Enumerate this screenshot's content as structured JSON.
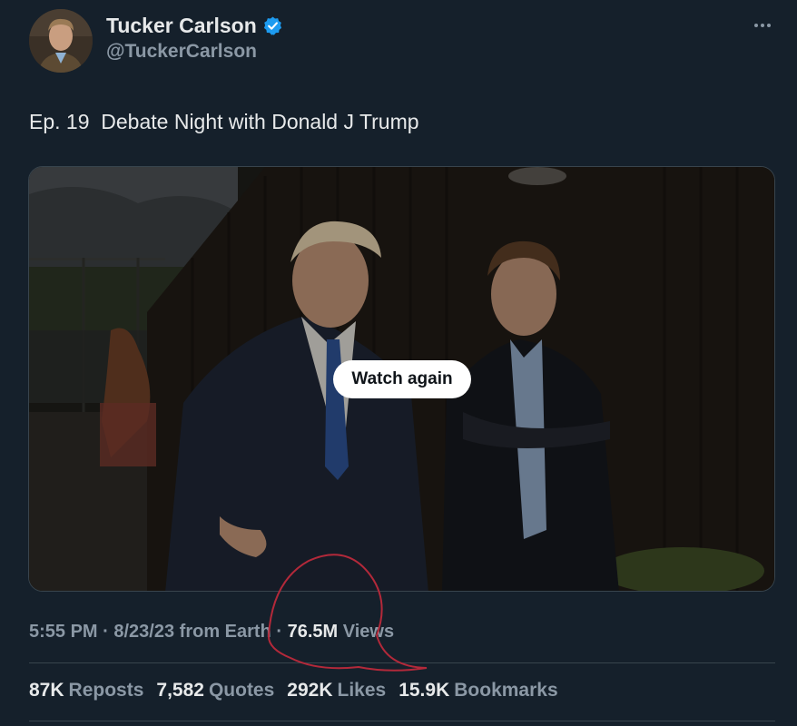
{
  "author": {
    "name": "Tucker Carlson",
    "handle": "@TuckerCarlson",
    "verified_color": "#1d9bf0"
  },
  "more_icon": "ellipsis-icon",
  "tweet": {
    "text": "Ep. 19  Debate Night with Donald J Trump"
  },
  "media": {
    "overlay_button_label": "Watch again"
  },
  "meta": {
    "time": "5:55 PM",
    "date": "8/23/23",
    "location": "from Earth",
    "views_count": "76.5M",
    "views_label": "Views"
  },
  "stats": [
    {
      "count": "87K",
      "label": "Reposts"
    },
    {
      "count": "7,582",
      "label": "Quotes"
    },
    {
      "count": "292K",
      "label": "Likes"
    },
    {
      "count": "15.9K",
      "label": "Bookmarks"
    }
  ],
  "colors": {
    "background": "#15202b",
    "primary_text": "#e7e9ea",
    "secondary_text": "#8b98a5",
    "annotation": "#b3293a"
  }
}
